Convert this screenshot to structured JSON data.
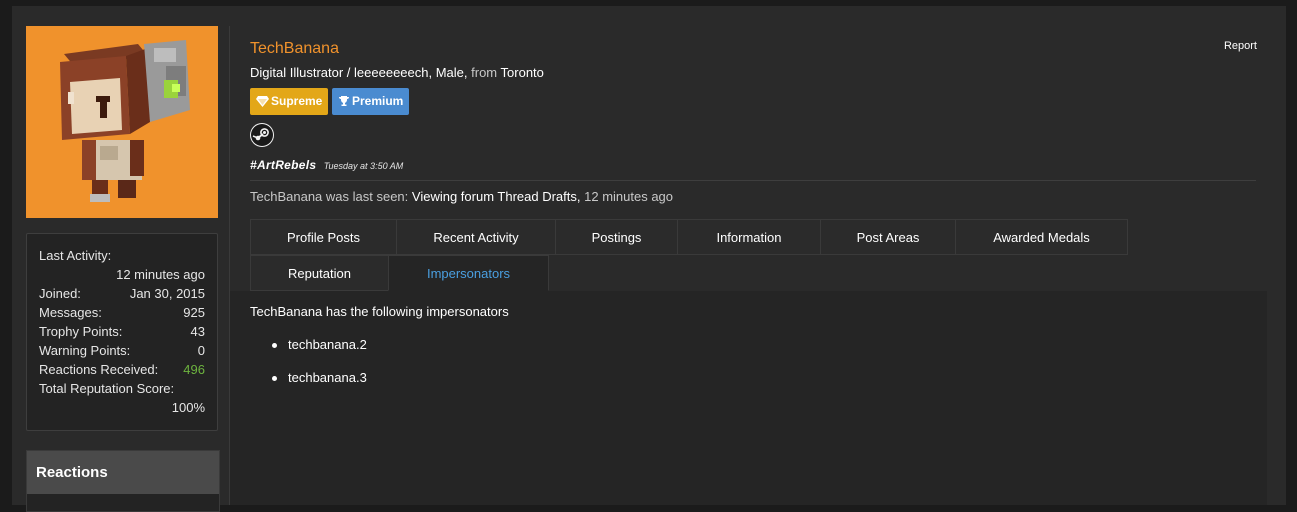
{
  "sidebar": {
    "stats": [
      {
        "label": "Last Activity:",
        "value": "12 minutes ago"
      },
      {
        "label": "Joined:",
        "value": "Jan 30, 2015"
      },
      {
        "label": "Messages:",
        "value": "925"
      },
      {
        "label": "Trophy Points:",
        "value": "43"
      },
      {
        "label": "Warning Points:",
        "value": "0"
      },
      {
        "label": "Reactions Received:",
        "value": "496"
      },
      {
        "label": "Total Reputation Score:",
        "value": "100%"
      }
    ],
    "reactions_title": "Reactions"
  },
  "profile": {
    "username": "TechBanana",
    "report_label": "Report",
    "title": "Digital Illustrator / leeeeeeeech, Male,",
    "from_word": "from",
    "location": "Toronto",
    "badges": [
      {
        "label": "Supreme",
        "color": "#e3a718",
        "icon": "diamond-icon"
      },
      {
        "label": "Premium",
        "color": "#4a8bd0",
        "icon": "trophy-icon"
      }
    ],
    "status_message": "#ArtRebels",
    "status_time": "Tuesday at 3:50 AM",
    "last_seen_prefix": "TechBanana was last seen:",
    "last_seen_activity": "Viewing forum Thread Drafts,",
    "last_seen_time": "12 minutes ago"
  },
  "tabs": [
    "Profile Posts",
    "Recent Activity",
    "Postings",
    "Information",
    "Post Areas",
    "Awarded Medals",
    "Reputation",
    "Impersonators"
  ],
  "active_tab": "Impersonators",
  "content": {
    "intro": "TechBanana has the following impersonators",
    "impersonators": [
      "techbanana.2",
      "techbanana.3"
    ]
  },
  "colors": {
    "accent_orange": "#f0922c",
    "link_blue": "#4a9fe0",
    "reactions_green": "#6db33f"
  }
}
